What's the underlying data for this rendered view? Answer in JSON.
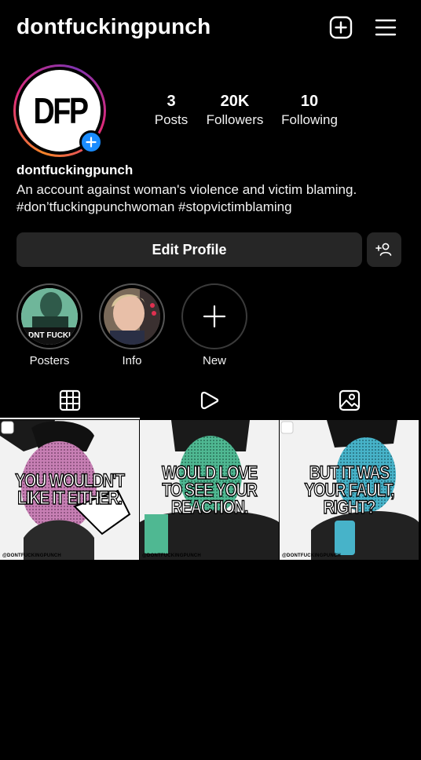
{
  "header": {
    "username": "dontfuckingpunch",
    "icons": [
      "new-post-icon",
      "menu-icon"
    ]
  },
  "avatar": {
    "text": "DFP"
  },
  "stats": [
    {
      "value": "3",
      "label": "Posts"
    },
    {
      "value": "20K",
      "label": "Followers"
    },
    {
      "value": "10",
      "label": "Following"
    }
  ],
  "profile": {
    "name": "dontfuckingpunch",
    "bio_line1": "An account against woman's violence and victim blaming.",
    "bio_line2": "#don’tfuckingpunchwoman #stopvictimblaming"
  },
  "actions": {
    "edit_label": "Edit Profile"
  },
  "highlights": [
    {
      "label": "Posters"
    },
    {
      "label": "Info"
    },
    {
      "label": "New"
    }
  ],
  "tabs": [
    "grid-icon",
    "reels-icon",
    "tagged-icon"
  ],
  "posts": [
    {
      "line1": "YOU WOULDN'T",
      "line2": "LIKE IT EITHER.",
      "handle": "@DONTFUCKINGPUNCH",
      "accent": "#c77fb4"
    },
    {
      "line1": "WOULD  LOVE",
      "line2": "TO SEE YOUR",
      "line3": "REACTION.",
      "handle": "@DONTFUCKINGPUNCH",
      "accent": "#4fb892"
    },
    {
      "line1": "BUT  IT  WAS",
      "line2": "YOUR  FAULT,",
      "line3": "RIGHT?",
      "handle": "@DONTFUCKINGPUNCH",
      "accent": "#47b3c9"
    }
  ],
  "colors": {
    "background": "#000000",
    "button": "#262626",
    "accent_blue": "#1a8cff"
  }
}
